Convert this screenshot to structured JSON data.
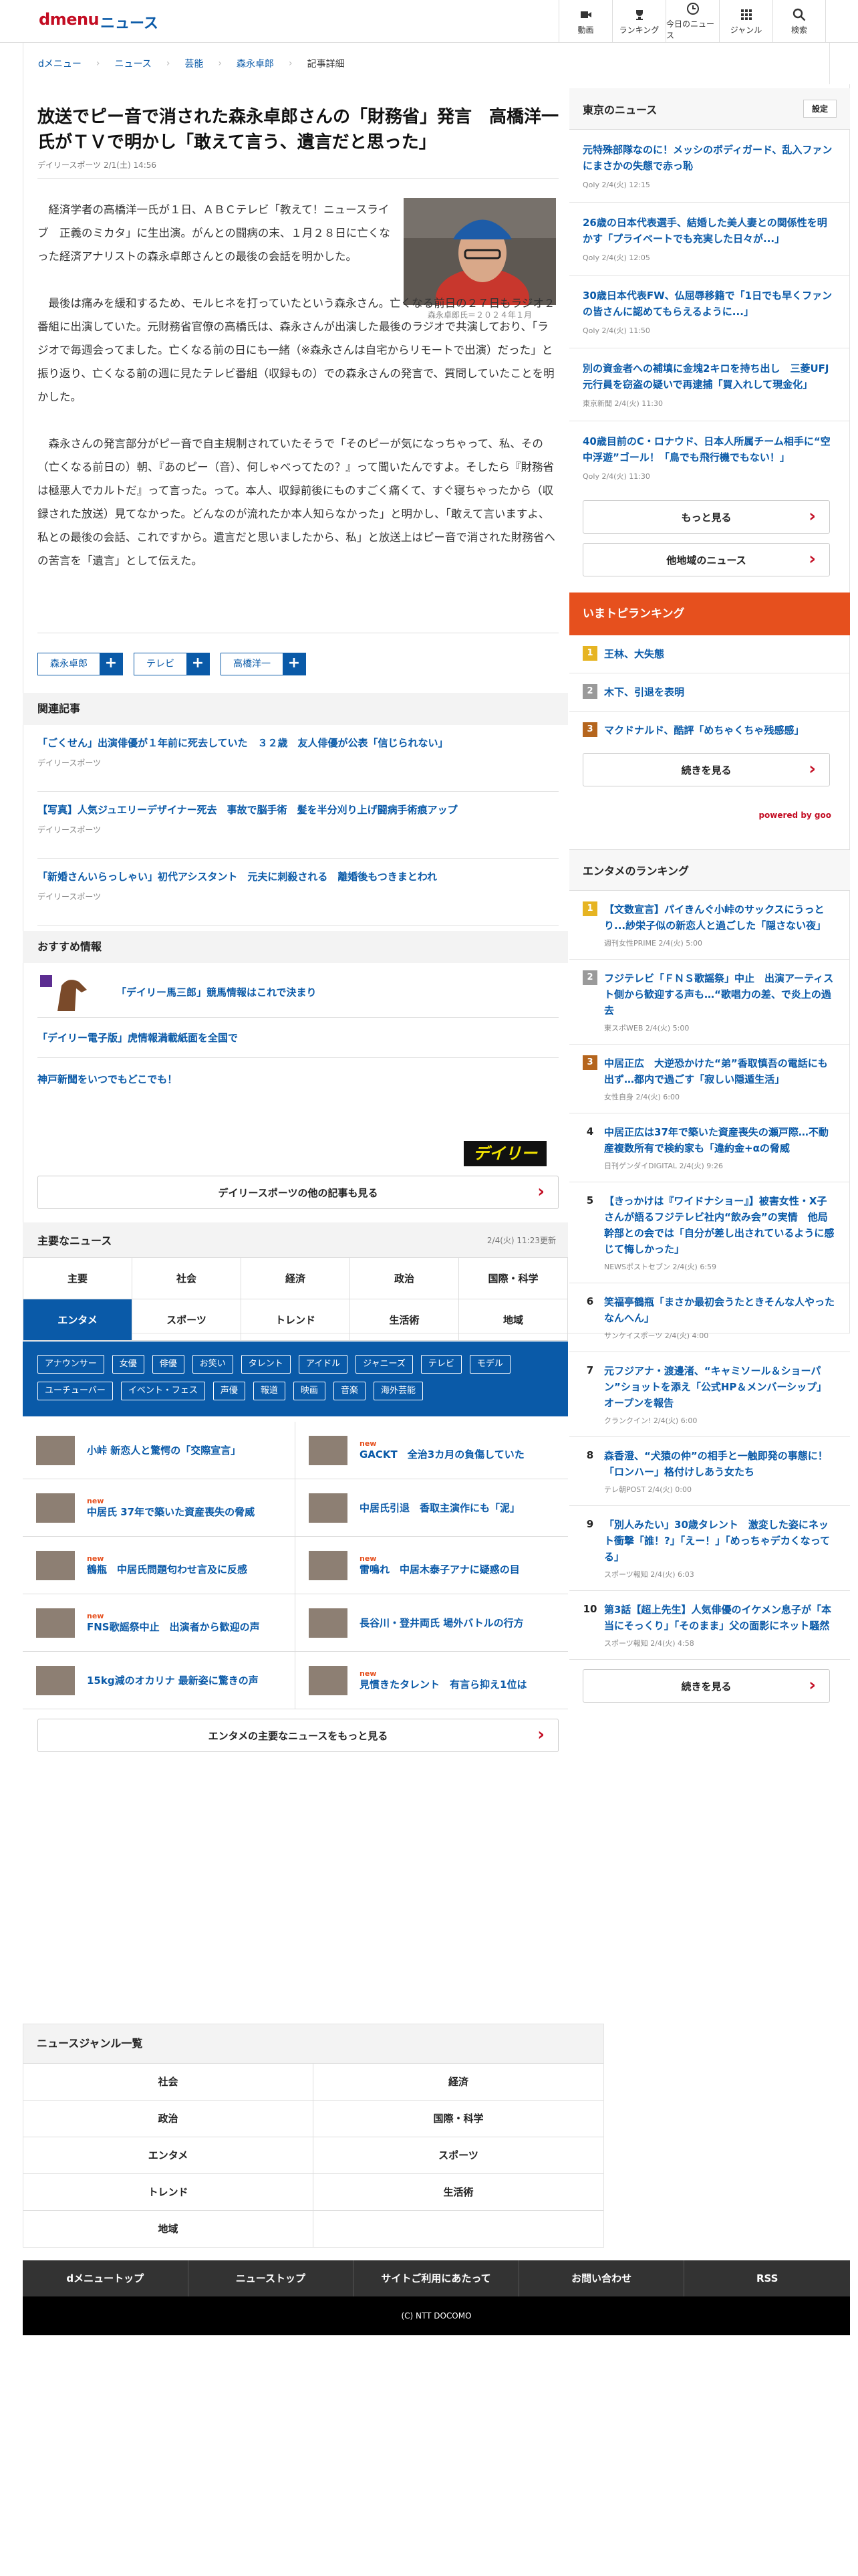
{
  "header": {
    "logo": "dmenu",
    "site": "ニュース",
    "nav": [
      "動画",
      "ランキング",
      "今日のニュース",
      "ジャンル",
      "検索"
    ]
  },
  "breadcrumb": [
    "dメニュー",
    "ニュース",
    "芸能",
    "森永卓郎",
    "記事詳細"
  ],
  "article": {
    "title": "放送でピー音で消された森永卓郎さんの「財務省」発言　高橋洋一氏がＴＶで明かし「敢えて言う、遺言だと思った」",
    "source": "デイリースポーツ 2/1(土) 14:56",
    "photo_caption": "森永卓郎氏＝２０２４年１月",
    "paragraphs": [
      "経済学者の高橋洋一氏が１日、ＡＢＣテレビ「教えて！ニュースライブ　正義のミカタ」に生出演。がんとの闘病の末、１月２８日に亡くなった経済アナリストの森永卓郎さんとの最後の会話を明かした。",
      "最後は痛みを緩和するため、モルヒネを打っていたという森永さん。亡くなる前日の２７日もラジオ２番組に出演していた。元財務省官僚の高橋氏は、森永さんが出演した最後のラジオで共演しており、「ラジオで毎週会ってました。亡くなる前の日にも一緒（※森永さんは自宅からリモートで出演）だった」と振り返り、亡くなる前の週に見たテレビ番組（収録もの）での森永さんの発言で、質問していたことを明かした。",
      "森永さんの発言部分がピー音で自主規制されていたそうで「そのピーが気になっちゃって、私、その（亡くなる前日の）朝、『あのピー（音）、何しゃべってたの？』って聞いたんですよ。そしたら『財務省は極悪人でカルトだ』って言った。って。本人、収録前後にものすごく痛くて、すぐ寝ちゃったから（収録された放送）見てなかった。どんなのが流れたか本人知らなかった」と明かし、「敢えて言いますよ、私との最後の会話、これですから。遺言だと思いましたから、私」と放送上はピー音で消された財務省への苦言を「遺言」として伝えた。"
    ],
    "tags": [
      "森永卓郎",
      "テレビ",
      "高橋洋一"
    ]
  },
  "related": {
    "heading": "関連記事",
    "items": [
      {
        "title": "「ごくせん」出演俳優が１年前に死去していた　３２歳　友人俳優が公表「信じられない」",
        "source": "デイリースポーツ"
      },
      {
        "title": "【写真】人気ジュエリーデザイナー死去　事故で脳手術　髪を半分刈り上げ闘病手術痕アップ",
        "source": "デイリースポーツ"
      },
      {
        "title": "「新婚さんいらっしゃい」初代アシスタント　元夫に刺殺される　離婚後もつきまとわれ",
        "source": "デイリースポーツ"
      }
    ]
  },
  "recommend": {
    "heading": "おすすめ情報",
    "items": [
      "「デイリー馬三郎」競馬情報はこれで決まり",
      "「デイリー電子版」虎情報満載紙面を全国で",
      "神戸新聞をいつでもどこでも！"
    ],
    "more": "デイリースポーツの他の記事も見る",
    "brand": "デイリー"
  },
  "major": {
    "heading": "主要なニュース",
    "updated": "2/4(火) 11:23更新",
    "tabs": [
      "主要",
      "社会",
      "経済",
      "政治",
      "国際・科学",
      "エンタメ",
      "スポーツ",
      "トレンド",
      "生活術",
      "地域"
    ],
    "subtags": [
      "アナウンサー",
      "女優",
      "俳優",
      "お笑い",
      "タレント",
      "アイドル",
      "ジャニーズ",
      "テレビ",
      "モデル",
      "ユーチューバー",
      "イベント・フェス",
      "声優",
      "報道",
      "映画",
      "音楽",
      "海外芸能"
    ],
    "items": [
      {
        "title": "小峠 新恋人と驚愕の「交際宣言」",
        "new": ""
      },
      {
        "title": "GACKT　全治3カ月の負傷していた",
        "new": "new"
      },
      {
        "title": "中居氏 37年で築いた資産喪失の脅威",
        "new": "new"
      },
      {
        "title": "中居氏引退　香取主演作にも「泥」",
        "new": ""
      },
      {
        "title": "鶴瓶　中居氏問題匂わせ言及に反感",
        "new": "new"
      },
      {
        "title": "雷鳴れ　中居木泰子アナに疑惑の目",
        "new": "new"
      },
      {
        "title": "FNS歌謡祭中止　出演者から歓迎の声",
        "new": "new"
      },
      {
        "title": "長谷川・登井両氏 場外バトルの行方",
        "new": ""
      },
      {
        "title": "15kg減のオカリナ 最新姿に驚きの声",
        "new": ""
      },
      {
        "title": "見慣きたタレント　有言ら抑え1位は",
        "new": "new"
      }
    ],
    "more": "エンタメの主要なニュースをもっと見る"
  },
  "tokyo": {
    "heading": "東京のニュース",
    "setting": "設定",
    "items": [
      {
        "title": "元特殊部隊なのに！メッシのボディガード、乱入ファンにまさかの失態で赤っ恥",
        "source": "Qoly 2/4(火) 12:15"
      },
      {
        "title": "26歳の日本代表選手、結婚した美人妻との関係性を明かす「プライベートでも充実した日々が...」",
        "source": "Qoly 2/4(火) 12:05"
      },
      {
        "title": "30歳日本代表FW、仏屈辱移籍で「1日でも早くファンの皆さんに認めてもらえるように...」",
        "source": "Qoly 2/4(火) 11:50"
      },
      {
        "title": "別の資金者への補填に金塊2キロを持ち出し　三菱UFJ元行員を窃盗の疑いで再逮捕「買入れして現金化」",
        "source": "東京新聞 2/4(火) 11:30"
      },
      {
        "title": "40歳目前のC・ロナウド、日本人所属チーム相手に“空中浮遊”ゴール！「鳥でも飛行機でもない！」",
        "source": "Qoly 2/4(火) 11:30"
      }
    ],
    "more": "もっと見る",
    "other": "他地域のニュース"
  },
  "toprank": {
    "heading": "いまトピランキング",
    "items": [
      "王林、大失態",
      "木下、引退を表明",
      "マクドナルド、酷評「めちゃくちゃ残感感」"
    ],
    "more": "続きを見る",
    "powered": "powered by goo"
  },
  "entrank": {
    "heading": "エンタメのランキング",
    "items": [
      {
        "title": "【文数宣言】パイきんぐ小峠のサックスにうっとり...紗栄子似の新恋人と過ごした「隠さない夜」",
        "source": "週刊女性PRIME 2/4(火) 5:00"
      },
      {
        "title": "フジテレビ「ＦＮＳ歌謡祭」中止　出演アーティスト側から歓迎する声も…“歌唱力の差、で炎上の過去",
        "source": "東スポWEB 2/4(火) 5:00"
      },
      {
        "title": "中居正広　大逆恐かけた“弟”香取慎吾の電話にも出ず…都内で過ごす「寂しい隠遁生活」",
        "source": "女性自身 2/4(火) 6:00"
      },
      {
        "title": "中居正広は37年で築いた資産喪失の瀬戸際…不動産複数所有で検約家も「違約金+αの脅威",
        "source": "日刊ゲンダイDIGITAL 2/4(火) 9:26"
      },
      {
        "title": "【きっかけは『ワイドナショー』】被害女性・X子さんが語るフジテレビ社内“飲み会”の実情　他局幹部との会では「自分が差し出されているように感じて悔しかった」",
        "source": "NEWSポストセブン 2/4(火) 6:59"
      },
      {
        "title": "笑福亭鶴瓶「まさか最初会うたときそんな人やったなんへん」",
        "source": "サンケイスポーツ 2/4(火) 4:00"
      },
      {
        "title": "元フジアナ・渡邊渚、“キャミソール＆ショーパン”ショットを添え「公式HP＆メンバーシップ」オープンを報告",
        "source": "クランクイン! 2/4(火) 6:00"
      },
      {
        "title": "森香澄、“犬猿の仲”の相手と一触即発の事態に！「ロンハー」格付けしあう女たち",
        "source": "テレ朝POST 2/4(火) 0:00"
      },
      {
        "title": "「別人みたい」30歳タレント　激変した姿にネット衝撃「誰！?」「えー！」「めっちゃデカくなってる」",
        "source": "スポーツ報知 2/4(火) 6:03"
      },
      {
        "title": "第3話【超上先生】人気俳優のイケメン息子が「本当にそっくり」「そのまま」父の面影にネット騒然",
        "source": "スポーツ報知 2/4(火) 4:58"
      }
    ],
    "more": "続きを見る"
  },
  "genre": {
    "heading": "ニュースジャンル一覧",
    "items": [
      "社会",
      "経済",
      "政治",
      "国際・科学",
      "エンタメ",
      "スポーツ",
      "トレンド",
      "生活術",
      "地域",
      ""
    ]
  },
  "footer": {
    "links": [
      "dメニュートップ",
      "ニューストップ",
      "サイトご利用にあたって",
      "お問い合わせ",
      "RSS"
    ],
    "copyright": "(C) NTT DOCOMO"
  }
}
